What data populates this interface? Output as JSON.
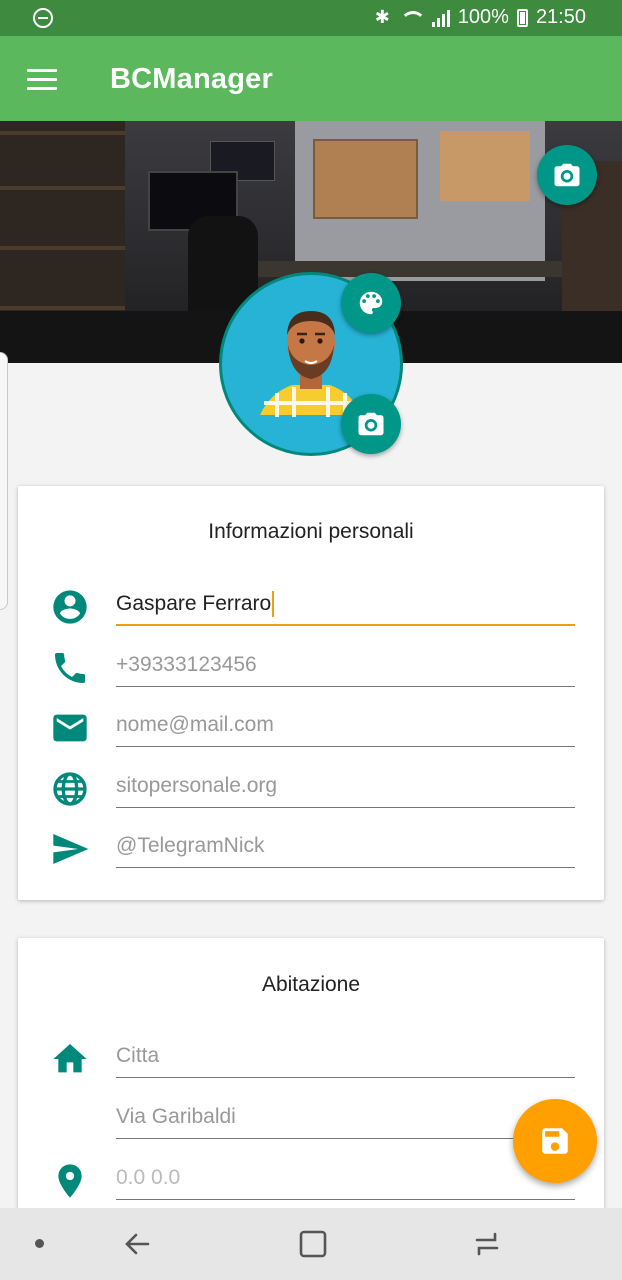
{
  "status_bar": {
    "battery": "100%",
    "time": "21:50"
  },
  "app_bar": {
    "title": "BCManager"
  },
  "personal_card": {
    "title": "Informazioni personali",
    "fields": [
      {
        "icon": "account-circle-icon",
        "value": "Gaspare Ferraro",
        "placeholder": ""
      },
      {
        "icon": "phone-icon",
        "value": "",
        "placeholder": "+39333123456"
      },
      {
        "icon": "email-icon",
        "value": "",
        "placeholder": "nome@mail.com"
      },
      {
        "icon": "globe-icon",
        "value": "",
        "placeholder": "sitopersonale.org"
      },
      {
        "icon": "send-icon",
        "value": "",
        "placeholder": "@TelegramNick"
      }
    ]
  },
  "home_card": {
    "title": "Abitazione",
    "fields": [
      {
        "icon": "home-icon",
        "value": "",
        "placeholder": "Citta"
      },
      {
        "icon": "",
        "value": "",
        "placeholder": "Via Garibaldi"
      },
      {
        "icon": "location-pin-icon",
        "value": "",
        "placeholder": "0.0 0.0"
      }
    ]
  },
  "colors": {
    "status_bar": "#3e8a3e",
    "app_bar": "#5cb85c",
    "accent": "#009688",
    "active_underline": "#f39c12",
    "save_fab": "#ff9f00",
    "avatar_bg": "#26b3d5"
  }
}
